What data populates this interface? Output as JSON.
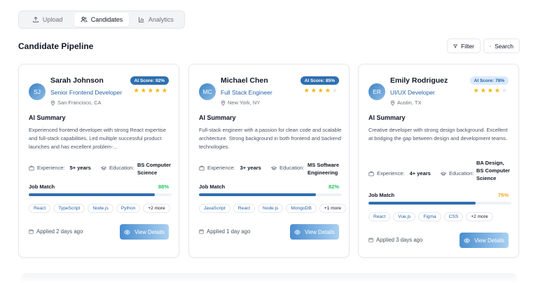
{
  "tabs": [
    {
      "label": "Upload",
      "icon": "upload-icon"
    },
    {
      "label": "Candidates",
      "icon": "users-icon",
      "active": true
    },
    {
      "label": "Analytics",
      "icon": "bar-chart-icon"
    }
  ],
  "header": {
    "title": "Candidate Pipeline",
    "filter_label": "Filter",
    "search_label": "Search"
  },
  "labels": {
    "ai_summary": "AI Summary",
    "experience": "Experience:",
    "education": "Education:",
    "job_match": "Job Match",
    "view_details": "View Details"
  },
  "colors": {
    "accent": "#2f6fb0",
    "match_high": "#22c55e",
    "match_mid": "#f5a623",
    "star": "#f5b400"
  },
  "candidates": [
    {
      "initials": "SJ",
      "name": "Sarah Johnson",
      "role": "Senior Frontend Developer",
      "location": "San Francisco, CA",
      "score": "AI Score: 92%",
      "stars": 5,
      "summary": "Experienced frontend developer with strong React expertise and full-stack capabilities. Led multiple successful product launches and has excellent problem-...",
      "experience": "5+ years",
      "education": [
        "BS Computer",
        "Science"
      ],
      "match": "88%",
      "match_value": 0.88,
      "tags": [
        "React",
        "TypeScript",
        "Node.js",
        "Python"
      ],
      "more": "+2 more",
      "applied": "Applied 2 days ago"
    },
    {
      "initials": "MC",
      "name": "Michael Chen",
      "role": "Full Stack Engineer",
      "location": "New York, NY",
      "score": "AI Score: 85%",
      "stars": 4,
      "summary": "Full-stack engineer with a passion for clean code and scalable architecture. Strong background in both frontend and backend technologies.",
      "experience": "3+ years",
      "education": [
        "MS Software",
        "Engineering"
      ],
      "match": "82%",
      "match_value": 0.82,
      "tags": [
        "JavaScript",
        "React",
        "Node.js",
        "MongoDB"
      ],
      "more": "+1 more",
      "applied": "Applied 1 day ago"
    },
    {
      "initials": "ER",
      "name": "Emily Rodriguez",
      "role": "UI/UX Developer",
      "location": "Austin, TX",
      "score": "AI Score: 78%",
      "stars": 4,
      "summary": "Creative developer with strong design background. Excellent at bridging the gap between design and development teams.",
      "experience": "4+ years",
      "education": [
        "BA Design,",
        "BS Computer",
        "Science"
      ],
      "match": "75%",
      "match_value": 0.75,
      "tags": [
        "React",
        "Vue.js",
        "Figma",
        "CSS"
      ],
      "more": "+2 more",
      "applied": "Applied 3 days ago"
    }
  ]
}
